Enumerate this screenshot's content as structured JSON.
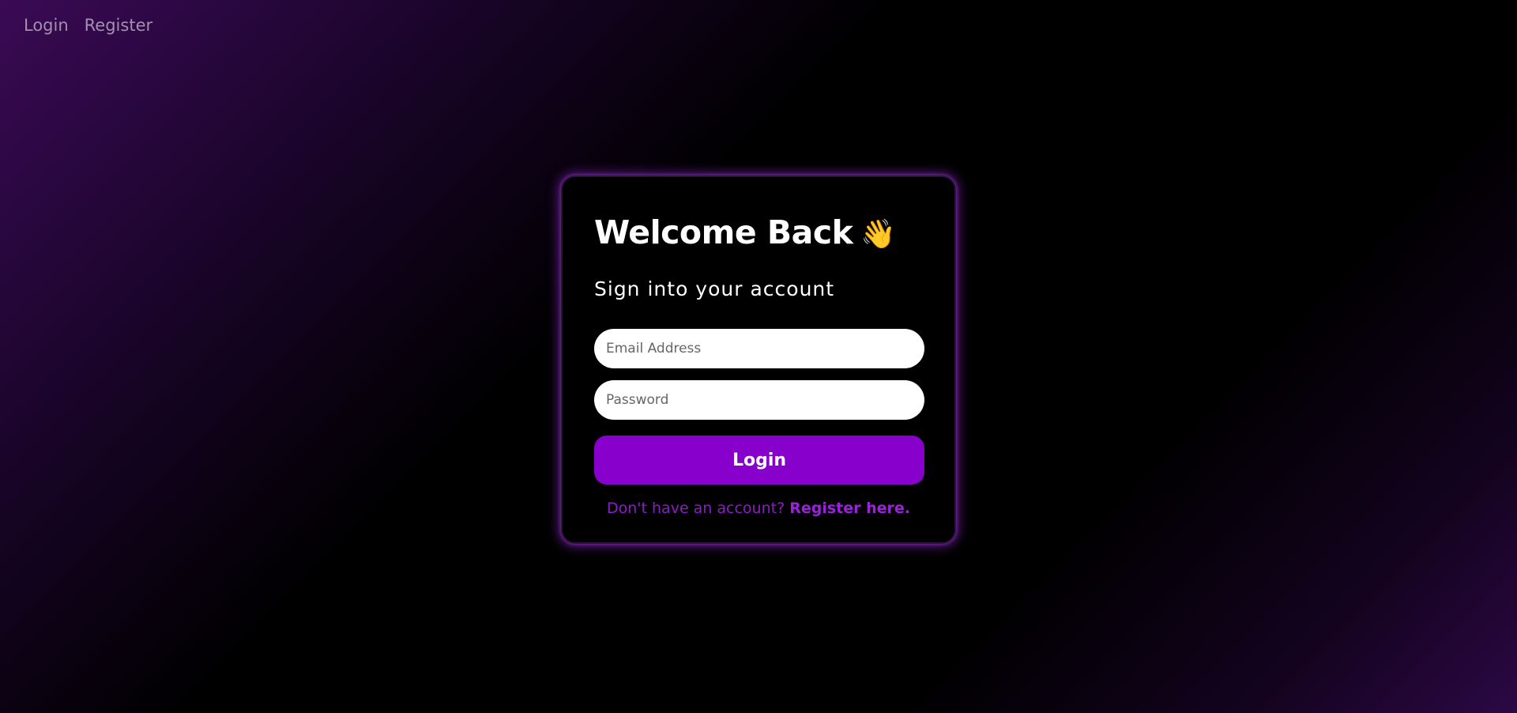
{
  "nav": {
    "login_label": "Login",
    "register_label": "Register"
  },
  "card": {
    "title": "Welcome Back",
    "title_emoji": "👋",
    "subtitle": "Sign into your account",
    "email_placeholder": "Email Address",
    "password_placeholder": "Password",
    "login_button_label": "Login",
    "no_account_text": "Don't have an account?",
    "register_link_label": "Register here."
  },
  "icons": {
    "wave": "waving-hand-icon"
  },
  "colors": {
    "accent": "#8800cc",
    "link": "#9a22d8",
    "nav_text": "#a48fb3",
    "glow": "#8c28c8"
  }
}
